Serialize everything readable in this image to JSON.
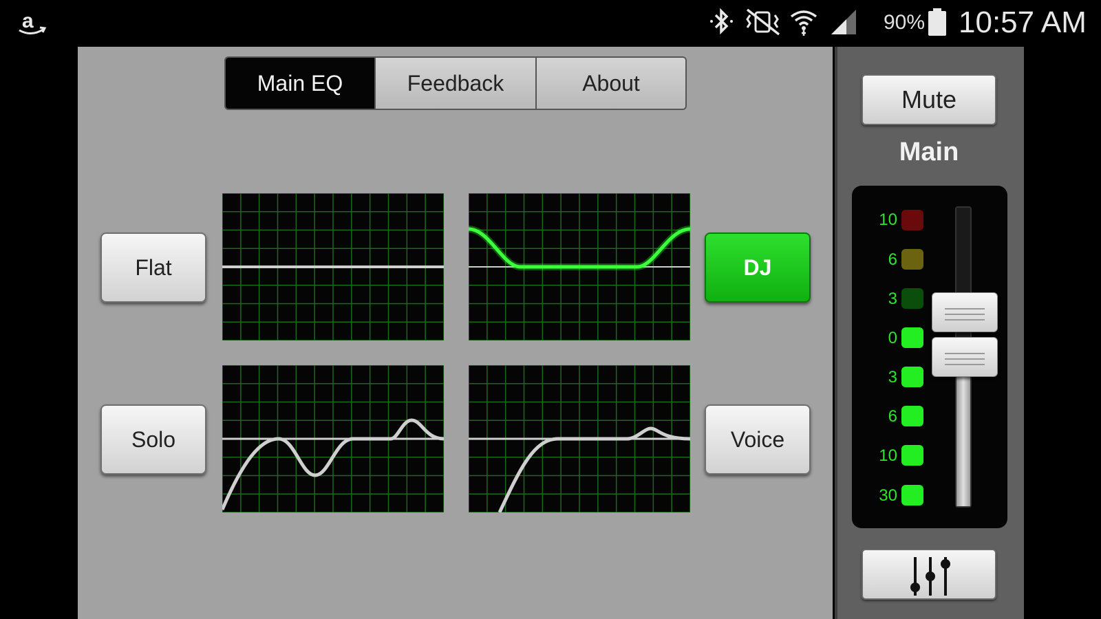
{
  "status_bar": {
    "app_icon": "amazon-icon",
    "icons": [
      "bluetooth-icon",
      "vibrate-mute-icon",
      "wifi-icon",
      "signal-icon",
      "battery-icon"
    ],
    "battery": "90%",
    "time": "10:57 AM"
  },
  "tabs": [
    {
      "label": "Main EQ",
      "active": true
    },
    {
      "label": "Feedback",
      "active": false
    },
    {
      "label": "About",
      "active": false
    }
  ],
  "presets": [
    {
      "label": "Flat",
      "active": false
    },
    {
      "label": "DJ",
      "active": true
    },
    {
      "label": "Solo",
      "active": false
    },
    {
      "label": "Voice",
      "active": false
    }
  ],
  "channel": {
    "mute_label": "Mute",
    "name": "Main",
    "meter_labels": [
      "10",
      "6",
      "3",
      "0",
      "3",
      "6",
      "10",
      "30"
    ],
    "meter_colors": [
      "#6a0a0a",
      "#6b6310",
      "#0b4d0b",
      "#22ee22",
      "#22ee22",
      "#22ee22",
      "#22ee22",
      "#22ee22"
    ],
    "mixer_icon": "mixer-sliders-icon"
  },
  "colors": {
    "accent_green": "#22dd22",
    "grid_green": "#1a6a1a",
    "panel_bg": "#a2a2a2"
  }
}
